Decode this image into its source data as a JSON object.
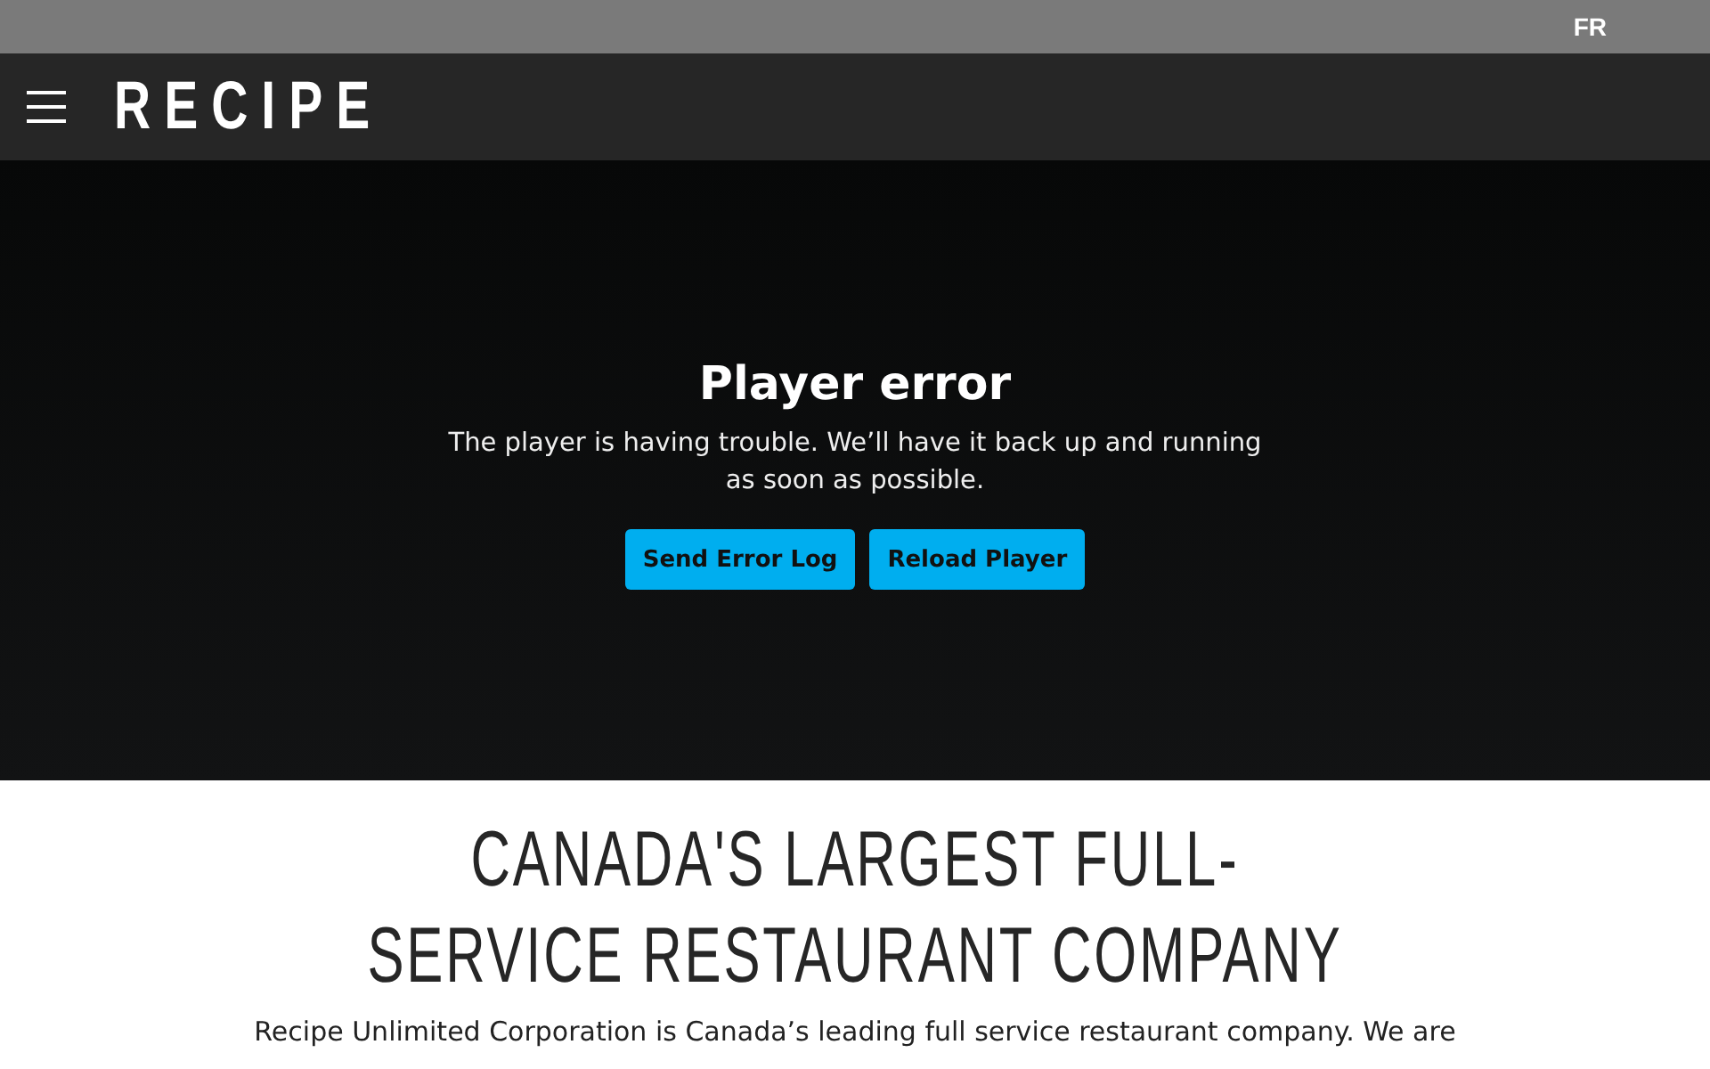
{
  "top_bar": {
    "language_link": "FR"
  },
  "header": {
    "logo": "RECIPE"
  },
  "player": {
    "title": "Player error",
    "message": "The player is having trouble. We’ll have it back up and running as soon as possible.",
    "buttons": [
      "Send Error Log",
      "Reload Player"
    ]
  },
  "intro": {
    "heading": "CANADA'S LARGEST FULL-SERVICE RESTAURANT COMPANY",
    "paragraph": "Recipe Unlimited Corporation is Canada’s leading full service restaurant company. We are"
  }
}
